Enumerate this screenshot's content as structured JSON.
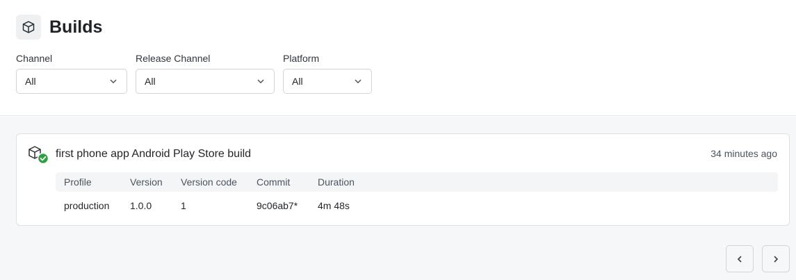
{
  "page": {
    "title": "Builds",
    "icon": "package-icon"
  },
  "filters": [
    {
      "label": "Channel",
      "value": "All"
    },
    {
      "label": "Release Channel",
      "value": "All"
    },
    {
      "label": "Platform",
      "value": "All"
    }
  ],
  "builds": [
    {
      "title": "first phone app Android Play Store build",
      "time": "34 minutes ago",
      "status": "success",
      "status_color": "#2ea043",
      "columns": [
        "Profile",
        "Version",
        "Version code",
        "Commit",
        "Duration"
      ],
      "values": [
        "production",
        "1.0.0",
        "1",
        "9c06ab7*",
        "4m 48s"
      ]
    }
  ],
  "pagination": {
    "prev_icon": "chevron-left-icon",
    "next_icon": "chevron-right-icon"
  }
}
